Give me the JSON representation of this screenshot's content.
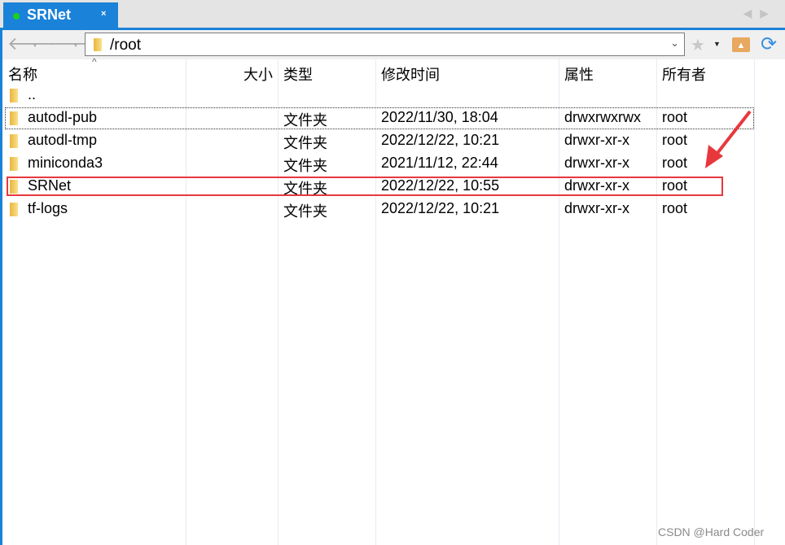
{
  "tab": {
    "title": "SRNet",
    "close": "×",
    "status_color": "#1bd11b"
  },
  "tab_nav": {
    "prev": "◀",
    "next": "▶"
  },
  "toolbar": {
    "back": "🡐",
    "forward": "🡒",
    "caret": "▼",
    "path": "/root",
    "dropdown": "⌄",
    "star": "★",
    "star_caret": "▼",
    "up_icon": "▲",
    "refresh": "⟳"
  },
  "columns": {
    "name": "名称",
    "size": "大小",
    "type": "类型",
    "modified": "修改时间",
    "perms": "属性",
    "owner": "所有者",
    "sort_indicator": "^"
  },
  "rows": [
    {
      "name": "..",
      "type": "",
      "modified": "",
      "perms": "",
      "owner": ""
    },
    {
      "name": "autodl-pub",
      "type": "文件夹",
      "modified": "2022/11/30, 18:04",
      "perms": "drwxrwxrwx",
      "owner": "root"
    },
    {
      "name": "autodl-tmp",
      "type": "文件夹",
      "modified": "2022/12/22, 10:21",
      "perms": "drwxr-xr-x",
      "owner": "root"
    },
    {
      "name": "miniconda3",
      "type": "文件夹",
      "modified": "2021/11/12, 22:44",
      "perms": "drwxr-xr-x",
      "owner": "root"
    },
    {
      "name": "SRNet",
      "type": "文件夹",
      "modified": "2022/12/22, 10:55",
      "perms": "drwxr-xr-x",
      "owner": "root"
    },
    {
      "name": "tf-logs",
      "type": "文件夹",
      "modified": "2022/12/22, 10:21",
      "perms": "drwxr-xr-x",
      "owner": "root"
    }
  ],
  "annotation": {
    "highlight_color": "#e8383d",
    "highlighted_row": "SRNet"
  },
  "watermark": "CSDN @Hard Coder"
}
